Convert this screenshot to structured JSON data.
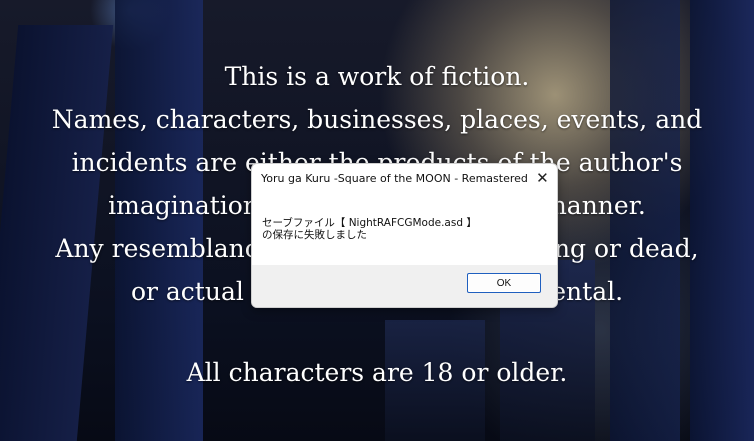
{
  "screen": {
    "intro_lines": [
      "This is a work of fiction.",
      "Names, characters, businesses, places, events, and",
      "incidents are either the products of the author's",
      "imagination or used in a fictitious manner.",
      "Any resemblance to actual persons, living or dead,",
      "or actual events is purely coincidental."
    ],
    "age_notice": "All characters are 18 or older."
  },
  "dialog": {
    "title": "Yoru ga Kuru -Square of the MOON - Remastered",
    "close_icon": "close-icon",
    "message_line1": "セーブファイル【 NightRAFCGMode.asd 】",
    "message_line2": "の保存に失敗しました",
    "ok_label": "OK"
  },
  "colors": {
    "background": "#0b1020",
    "text": "#ffffff",
    "dialog_bg": "#ffffff",
    "dialog_footer_bg": "#f0f0f0",
    "ok_border": "#1f5fbf"
  }
}
